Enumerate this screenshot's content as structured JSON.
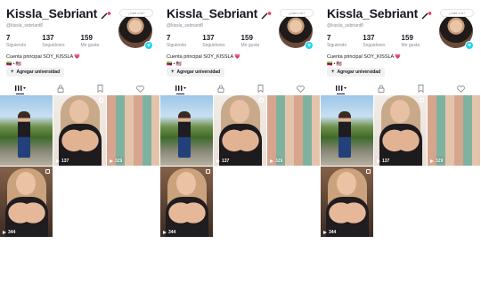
{
  "profile": {
    "username": "Kissla_Sebriant",
    "handle": "@kissla_sebriant8",
    "stats": [
      {
        "value": "7",
        "label": "Siguiendo"
      },
      {
        "value": "137",
        "label": "Seguidores"
      },
      {
        "value": "159",
        "label": "Me gusta"
      }
    ],
    "bio": "Cuenta principal SOY_KISSLA 💗",
    "flags": "🇻🇪 • 🇺🇸",
    "add_university_label": "Agregar universidad",
    "add_university_icon": "+",
    "bubble_text": "¿Café o té?",
    "avatar_plus": "+"
  },
  "tabs": [
    "videos-grid",
    "private-lock",
    "bookmark",
    "liked-heart"
  ],
  "videos": [
    {
      "views": "",
      "style": "img-a"
    },
    {
      "views": "137",
      "style": "img-b"
    },
    {
      "views": "329",
      "style": "img-c"
    },
    {
      "views": "344",
      "style": "img-d"
    }
  ],
  "colors": {
    "accent": "#20d5ec",
    "flag_pink": "#fe2c55",
    "text": "#161823",
    "muted": "#8a8b91"
  }
}
